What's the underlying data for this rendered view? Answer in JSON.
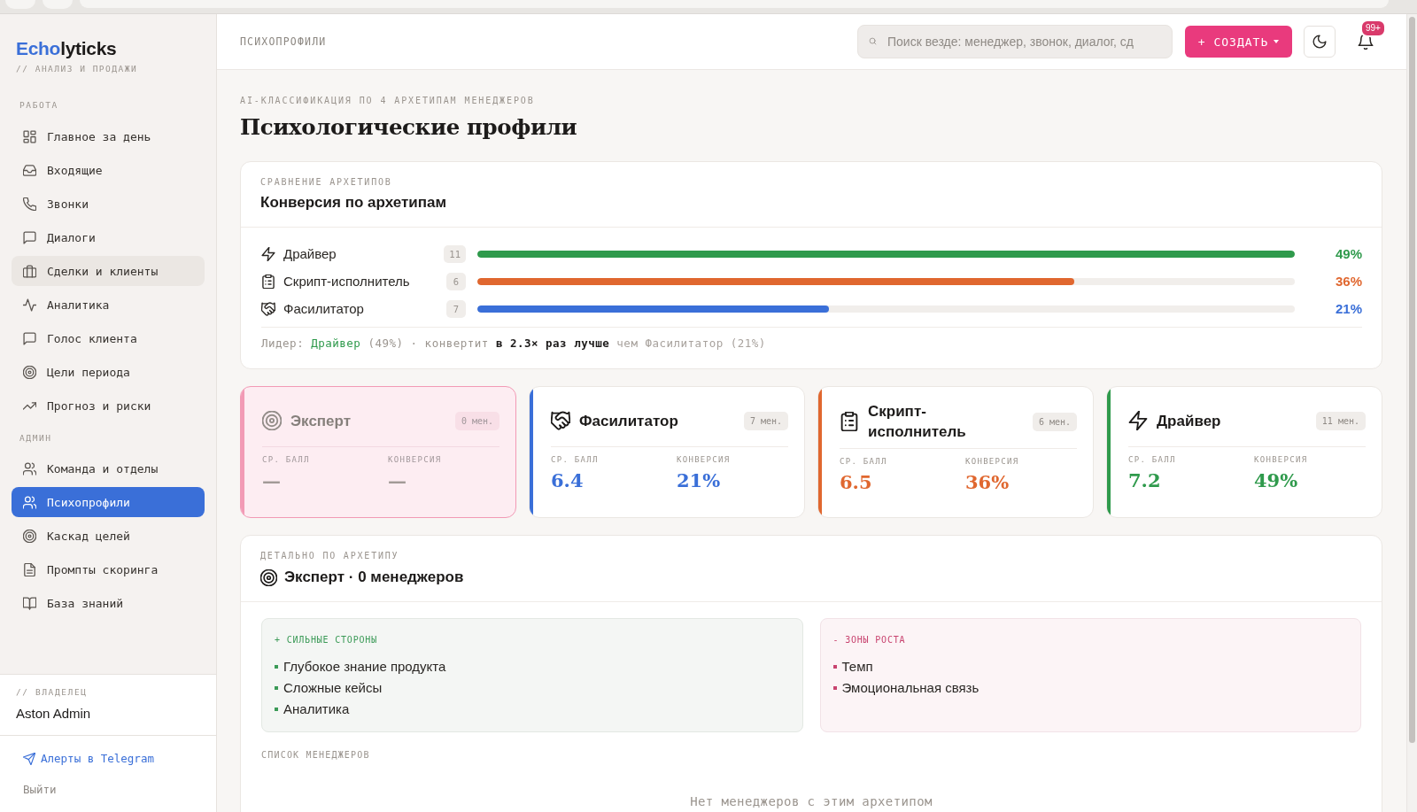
{
  "sidebar": {
    "logo": {
      "accent": "Echo",
      "rest": "lyticks"
    },
    "tagline": "// АНАЛИЗ И ПРОДАЖИ",
    "sections": [
      {
        "title": "РАБОТА",
        "items": [
          {
            "label": "Главное за день",
            "selected": false,
            "hovered": false
          },
          {
            "label": "Входящие",
            "selected": false,
            "hovered": false
          },
          {
            "label": "Звонки",
            "selected": false,
            "hovered": false
          },
          {
            "label": "Диалоги",
            "selected": false,
            "hovered": false
          },
          {
            "label": "Сделки и клиенты",
            "selected": false,
            "hovered": true
          },
          {
            "label": "Аналитика",
            "selected": false,
            "hovered": false
          },
          {
            "label": "Голос клиента",
            "selected": false,
            "hovered": false
          },
          {
            "label": "Цели периода",
            "selected": false,
            "hovered": false
          },
          {
            "label": "Прогноз и риски",
            "selected": false,
            "hovered": false
          }
        ]
      },
      {
        "title": "АДМИН",
        "items": [
          {
            "label": "Команда и отделы",
            "selected": false,
            "hovered": false
          },
          {
            "label": "Психопрофили",
            "selected": true,
            "hovered": false
          },
          {
            "label": "Каскад целей",
            "selected": false,
            "hovered": false
          },
          {
            "label": "Промпты скоринга",
            "selected": false,
            "hovered": false
          },
          {
            "label": "База знаний",
            "selected": false,
            "hovered": false
          }
        ]
      }
    ],
    "owner": {
      "label": "// ВЛАДЕЛЕЦ",
      "name": "Aston Admin"
    },
    "links": [
      {
        "kind": "telegram",
        "label": "Алерты в Telegram"
      },
      {
        "kind": "logout",
        "label": "Выйти"
      }
    ]
  },
  "header": {
    "breadcrumb": "ПСИХОПРОФИЛИ",
    "search": {
      "placeholder": "Поиск везде: менеджер, звонок, диалог, сд"
    },
    "create_button": "+ СОЗДАТЬ",
    "notifications": {
      "badge": "99+"
    }
  },
  "page": {
    "eyebrow": "AI-КЛАССИФИКАЦИЯ ПО 4 АРХЕТИПАМ МЕНЕДЖЕРОВ",
    "title": "Психологические профили"
  },
  "comparison": {
    "eyebrow": "СРАВНЕНИЕ АРХЕТИПОВ",
    "title": "Конверсия по архетипам",
    "rows": [
      {
        "kind": "driver",
        "name": "Драйвер",
        "count": "11",
        "level": 1,
        "percent": "49%",
        "color": "#2f9a4c"
      },
      {
        "kind": "script",
        "name": "Скрипт-исполнитель",
        "count": "6",
        "level": 0.73,
        "percent": "36%",
        "color": "#e0672f"
      },
      {
        "kind": "facilitator",
        "name": "Фасилитатор",
        "count": "7",
        "level": 0.43,
        "percent": "21%",
        "color": "#3a6fd8"
      }
    ],
    "summary": [
      {
        "kind": "muted",
        "text": "Лидер:"
      },
      {
        "kind": "leader",
        "text": "Драйвер"
      },
      {
        "kind": "muted",
        "text": "(49%) · конвертит"
      },
      {
        "kind": "strong",
        "text": "в 2.3× раз лучше"
      },
      {
        "kind": "faint",
        "text": "чем Фасилитатор (21%)"
      }
    ]
  },
  "archetypes": [
    {
      "kind": "expert",
      "name": "Эксперт",
      "count": "0 мен.",
      "color": "#f29ab5",
      "selected": true,
      "disabled": true,
      "metrics": [
        {
          "label": "СР. БАЛЛ",
          "value": "—"
        },
        {
          "label": "КОНВЕРСИЯ",
          "value": "—"
        }
      ]
    },
    {
      "kind": "facilitator",
      "name": "Фасилитатор",
      "count": "7 мен.",
      "color": "#3a6fd8",
      "selected": false,
      "disabled": false,
      "metrics": [
        {
          "label": "СР. БАЛЛ",
          "value": "6.4"
        },
        {
          "label": "КОНВЕРСИЯ",
          "value": "21%"
        }
      ]
    },
    {
      "kind": "script",
      "name": "Скрипт-исполнитель",
      "count": "6 мен.",
      "color": "#e0672f",
      "selected": false,
      "disabled": false,
      "metrics": [
        {
          "label": "СР. БАЛЛ",
          "value": "6.5"
        },
        {
          "label": "КОНВЕРСИЯ",
          "value": "36%"
        }
      ]
    },
    {
      "kind": "driver",
      "name": "Драйвер",
      "count": "11 мен.",
      "color": "#2f9a4c",
      "selected": false,
      "disabled": false,
      "metrics": [
        {
          "label": "СР. БАЛЛ",
          "value": "7.2"
        },
        {
          "label": "КОНВЕРСИЯ",
          "value": "49%"
        }
      ]
    }
  ],
  "detail": {
    "eyebrow": "ДЕТАЛЬНО ПО АРХЕТИПУ",
    "kind": "expert",
    "title": "Эксперт · 0 менеджеров",
    "panels": [
      {
        "kind": "strengths",
        "title": "+ СИЛЬНЫЕ СТОРОНЫ",
        "items": [
          "Глубокое знание продукта",
          "Сложные кейсы",
          "Аналитика"
        ]
      },
      {
        "kind": "growth",
        "title": "- ЗОНЫ РОСТА",
        "items": [
          "Темп",
          "Эмоциональная связь"
        ]
      }
    ],
    "managers": {
      "title": "СПИСОК МЕНЕДЖЕРОВ",
      "empty_text": "Нет менеджеров с этим архетипом"
    }
  }
}
